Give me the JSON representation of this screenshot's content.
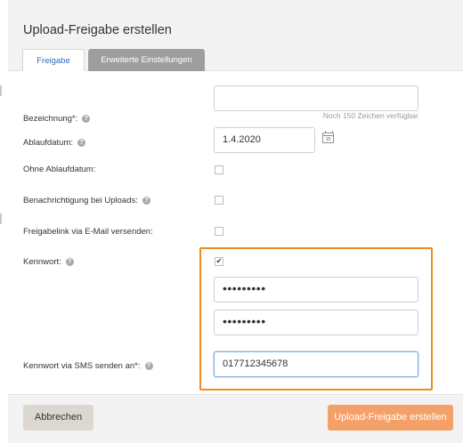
{
  "dialog": {
    "title": "Upload-Freigabe erstellen",
    "tabs": [
      {
        "label": "Freigabe",
        "active": true
      },
      {
        "label": "Erweiterte Einstellungen",
        "active": false
      }
    ]
  },
  "form": {
    "bezeichnung": {
      "label": "Bezeichnung*:",
      "value": "",
      "counter": "Noch 150 Zeichen verfügbar"
    },
    "ablaufdatum": {
      "label": "Ablaufdatum:",
      "value": "1.4.2020",
      "calendar_day": "15"
    },
    "ohne_ablaufdatum": {
      "label": "Ohne Ablaufdatum:",
      "checked": false
    },
    "benachrichtigung": {
      "label": "Benachrichtigung bei Uploads:",
      "checked": false
    },
    "freigabelink_email": {
      "label": "Freigabelink via E-Mail versenden:",
      "checked": false
    },
    "kennwort": {
      "label": "Kennwort:",
      "checked": true,
      "check_glyph": "✔",
      "password": "•••••••••",
      "password_confirm": "•••••••••"
    },
    "kennwort_sms": {
      "label": "Kennwort via SMS senden an*:",
      "value": "017712345678"
    }
  },
  "help_icon_glyph": "?",
  "footer": {
    "cancel_label": "Abbrechen",
    "submit_label": "Upload-Freigabe erstellen"
  },
  "colors": {
    "accent_tab": "#2a6fb5",
    "highlight": "#f08a1c",
    "primary_button": "#f4a069",
    "cancel_button": "#dcd8d1"
  }
}
